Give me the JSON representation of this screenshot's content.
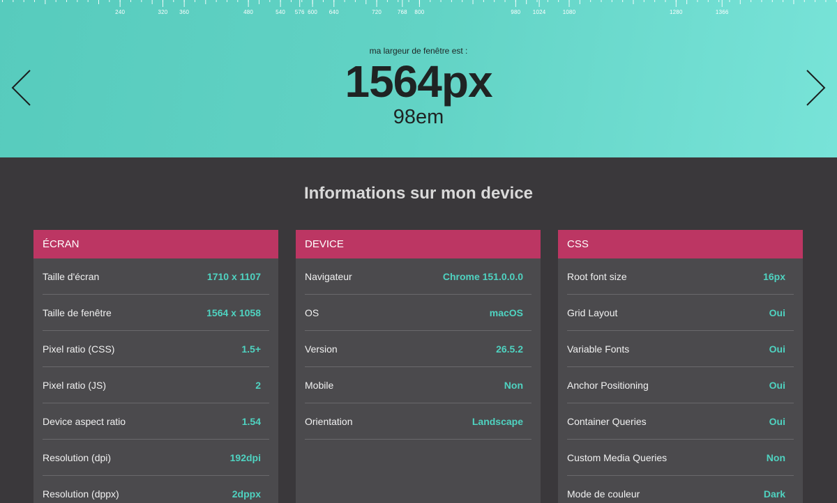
{
  "hero": {
    "ruler_ticks": [
      "240",
      "320",
      "360",
      "480",
      "540",
      "576",
      "600",
      "640",
      "720",
      "768",
      "800",
      "980",
      "1024",
      "1080",
      "1280",
      "1366"
    ],
    "caption": "ma largeur de fenêtre est :",
    "width_px": "1564px",
    "width_em": "98em",
    "prev_icon": "chevron-left",
    "next_icon": "chevron-right"
  },
  "section_title": "Informations sur mon device",
  "cards": [
    {
      "title": "ÉCRAN",
      "rows": [
        {
          "label": "Taille d'écran",
          "value": "1710 x 1107"
        },
        {
          "label": "Taille de fenêtre",
          "value": "1564 x 1058"
        },
        {
          "label": "Pixel ratio (CSS)",
          "value": "1.5+"
        },
        {
          "label": "Pixel ratio (JS)",
          "value": "2"
        },
        {
          "label": "Device aspect ratio",
          "value": "1.54"
        },
        {
          "label": "Resolution (dpi)",
          "value": "192dpi"
        },
        {
          "label": "Resolution (dppx)",
          "value": "2dppx"
        }
      ]
    },
    {
      "title": "DEVICE",
      "rows": [
        {
          "label": "Navigateur",
          "value": "Chrome 151.0.0.0"
        },
        {
          "label": "OS",
          "value": "macOS"
        },
        {
          "label": "Version",
          "value": "26.5.2"
        },
        {
          "label": "Mobile",
          "value": "Non"
        },
        {
          "label": "Orientation",
          "value": "Landscape"
        }
      ]
    },
    {
      "title": "CSS",
      "rows": [
        {
          "label": "Root font size",
          "value": "16px"
        },
        {
          "label": "Grid Layout",
          "value": "Oui"
        },
        {
          "label": "Variable Fonts",
          "value": "Oui"
        },
        {
          "label": "Anchor Positioning",
          "value": "Oui"
        },
        {
          "label": "Container Queries",
          "value": "Oui"
        },
        {
          "label": "Custom Media Queries",
          "value": "Non"
        },
        {
          "label": "Mode de couleur",
          "value": "Dark"
        }
      ]
    }
  ],
  "colors": {
    "hero_teal": "#62d3c5",
    "card_header": "#bc3663",
    "value_teal": "#4fd3c1",
    "page_bg": "#3a383b"
  }
}
